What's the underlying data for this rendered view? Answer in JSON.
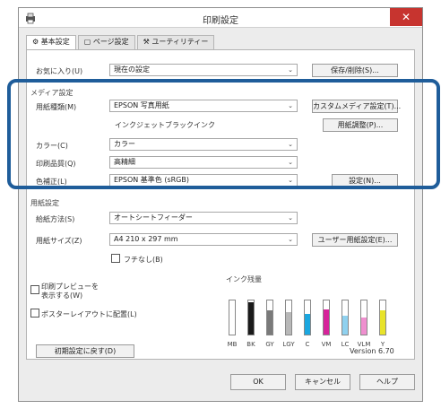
{
  "window": {
    "title": "印刷設定",
    "close_glyph": "✕"
  },
  "tabs": [
    {
      "label": "基本設定",
      "active": true
    },
    {
      "label": "ページ設定",
      "active": false
    },
    {
      "label": "ユーティリティー",
      "active": false
    }
  ],
  "favorites": {
    "label": "お気に入り(U)",
    "value": "現在の設定",
    "button": "保存/削除(S)..."
  },
  "media": {
    "section_label": "メディア設定",
    "paper_type_label": "用紙種類(M)",
    "paper_type_value": "EPSON 写真用紙",
    "custom_media_button": "カスタムメディア設定(T)...",
    "ink_label": "インクジェットブラックインク",
    "paper_adjust_button": "用紙調整(P)...",
    "color_label": "カラー(C)",
    "color_value": "カラー",
    "quality_label": "印刷品質(Q)",
    "quality_value": "高精細",
    "color_mode_label": "色補正(L)",
    "color_mode_value": "EPSON 基準色 (sRGB)",
    "settings_button": "設定(N)..."
  },
  "paper": {
    "section_label": "用紙設定",
    "source_label": "給紙方法(S)",
    "source_value": "オートシートフィーダー",
    "size_label": "用紙サイズ(Z)",
    "size_value": "A4 210 x 297 mm",
    "user_size_button": "ユーザー用紙設定(E)...",
    "borderless_label": "フチなし(B)"
  },
  "options": {
    "preview_line1": "印刷プレビューを",
    "preview_line2": "表示する(W)",
    "poster_label": "ポスターレイアウトに配置(L)"
  },
  "ink_levels": {
    "label": "インク残量",
    "inks": [
      {
        "name": "MB",
        "color": "#2a2a2a",
        "level": 0.0
      },
      {
        "name": "BK",
        "color": "#1a1a1a",
        "level": 0.95
      },
      {
        "name": "GY",
        "color": "#7a7a7a",
        "level": 0.7
      },
      {
        "name": "LGY",
        "color": "#b8b8b8",
        "level": 0.65
      },
      {
        "name": "C",
        "color": "#1aa7e0",
        "level": 0.6
      },
      {
        "name": "VM",
        "color": "#d6239a",
        "level": 0.75
      },
      {
        "name": "LC",
        "color": "#8fd1ef",
        "level": 0.55
      },
      {
        "name": "VLM",
        "color": "#ef8fcf",
        "level": 0.5
      },
      {
        "name": "Y",
        "color": "#e8e32a",
        "level": 0.7
      }
    ]
  },
  "footer": {
    "reset_button": "初期設定に戻す(D)",
    "version": "Version 6.70",
    "ok_button": "OK",
    "cancel_button": "キャンセル",
    "help_button": "ヘルプ"
  }
}
